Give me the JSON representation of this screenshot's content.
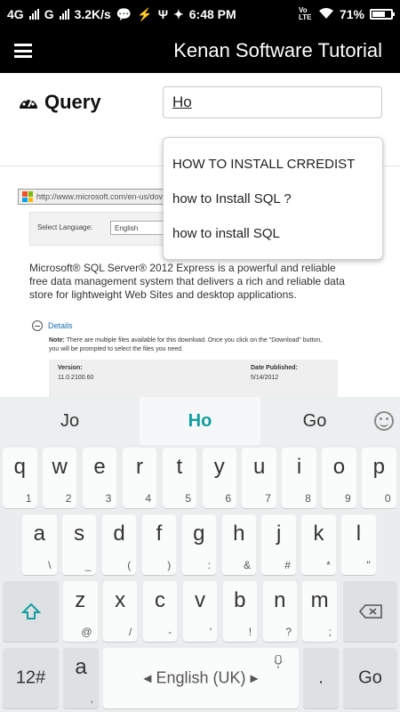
{
  "status_bar": {
    "network1": "4G",
    "network2": "G",
    "speed": "3.2K/s",
    "time": "6:48 PM",
    "volte": "Vo LTE",
    "battery_pct": "71%",
    "battery_level": 0.71
  },
  "app_bar": {
    "title": "Kenan Software Tutorial"
  },
  "query": {
    "label": "Query",
    "value": "Ho"
  },
  "suggestions": [
    "HOW TO INSTALL CRREDIST",
    "how to Install SQL ?",
    "how to install SQL"
  ],
  "content": {
    "url": "http://www.microsoft.com/en-us/dov",
    "language_label": "Select Language:",
    "language_value": "English",
    "description": "Microsoft® SQL Server® 2012 Express is a powerful and reliable free data management system that delivers a rich and reliable data store for lightweight Web Sites and desktop applications.",
    "details_label": "Details",
    "note_bold": "Note:",
    "note_text": " There are multiple files available for this download. Once you click on the \"Download\" button, you will be prompted to select the files you need.",
    "version_label": "Version:",
    "version_value": "11.0.2100.60",
    "date_label": "Date Published:",
    "date_value": "5/14/2012"
  },
  "keyboard": {
    "suggestions": [
      "Jo",
      "Ho",
      "Go"
    ],
    "accent_color": "#129ea0",
    "row1": [
      {
        "main": "q",
        "alt": "1"
      },
      {
        "main": "w",
        "alt": "2"
      },
      {
        "main": "e",
        "alt": "3"
      },
      {
        "main": "r",
        "alt": "4"
      },
      {
        "main": "t",
        "alt": "5"
      },
      {
        "main": "y",
        "alt": "6"
      },
      {
        "main": "u",
        "alt": "7"
      },
      {
        "main": "i",
        "alt": "8"
      },
      {
        "main": "o",
        "alt": "9"
      },
      {
        "main": "p",
        "alt": "0"
      }
    ],
    "row2": [
      {
        "main": "a",
        "alt": "\\"
      },
      {
        "main": "s",
        "alt": "_"
      },
      {
        "main": "d",
        "alt": "("
      },
      {
        "main": "f",
        "alt": ")"
      },
      {
        "main": "g",
        "alt": ":"
      },
      {
        "main": "h",
        "alt": "&"
      },
      {
        "main": "j",
        "alt": "#"
      },
      {
        "main": "k",
        "alt": "*"
      },
      {
        "main": "l",
        "alt": "\""
      }
    ],
    "row3": [
      {
        "main": "z",
        "alt": "@"
      },
      {
        "main": "x",
        "alt": "/"
      },
      {
        "main": "c",
        "alt": "-"
      },
      {
        "main": "v",
        "alt": "'"
      },
      {
        "main": "b",
        "alt": "!"
      },
      {
        "main": "n",
        "alt": "?"
      },
      {
        "main": "m",
        "alt": ";"
      }
    ],
    "symbols_key": "12#",
    "lang_key_main": "a",
    "lang_key_alt": ",",
    "space_label": "English (UK)",
    "space_left_arrow": "◂",
    "space_right_arrow": "▸",
    "period_key": ".",
    "go_key": "Go"
  }
}
